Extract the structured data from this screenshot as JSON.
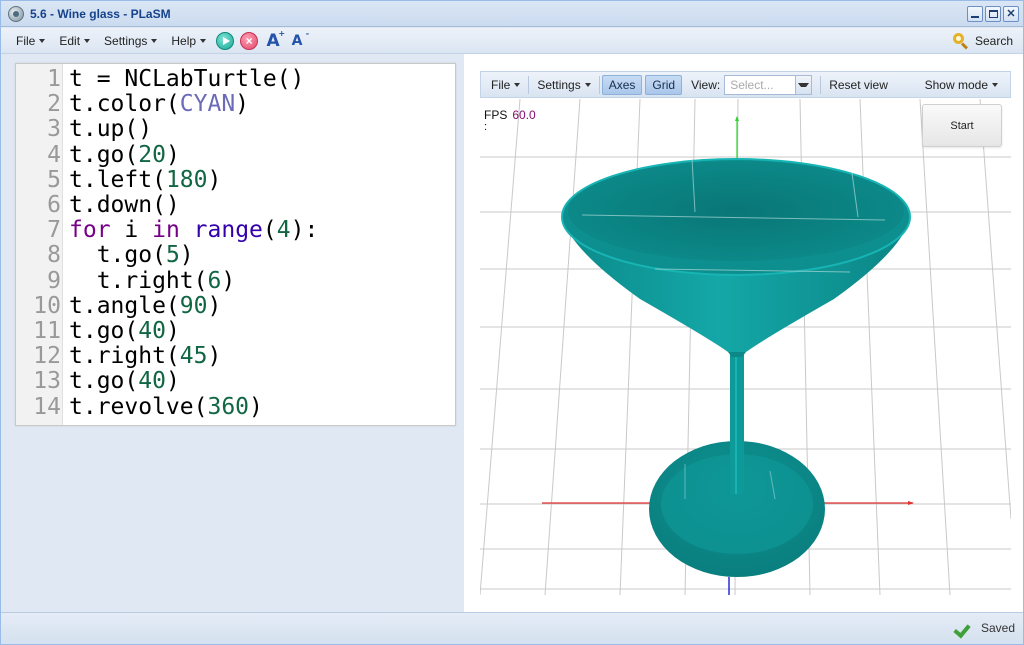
{
  "window": {
    "title": "5.6 - Wine glass - PLaSM"
  },
  "menubar": {
    "items": [
      {
        "label": "File"
      },
      {
        "label": "Edit"
      },
      {
        "label": "Settings"
      },
      {
        "label": "Help"
      }
    ],
    "search_label": "Search",
    "icons": [
      "play-icon",
      "stop-icon",
      "font-increase-icon",
      "font-decrease-icon"
    ]
  },
  "editor": {
    "lines": [
      {
        "n": "1",
        "tokens": [
          [
            "",
            "t = NCLabTurtle()"
          ]
        ]
      },
      {
        "n": "2",
        "tokens": [
          [
            "",
            "t.color("
          ],
          [
            "str",
            "CYAN"
          ],
          [
            "",
            ")"
          ]
        ]
      },
      {
        "n": "3",
        "tokens": [
          [
            "",
            "t.up()"
          ]
        ]
      },
      {
        "n": "4",
        "tokens": [
          [
            "",
            "t.go("
          ],
          [
            "num",
            "20"
          ],
          [
            "",
            ")"
          ]
        ]
      },
      {
        "n": "5",
        "tokens": [
          [
            "",
            "t.left("
          ],
          [
            "num",
            "180"
          ],
          [
            "",
            ")"
          ]
        ]
      },
      {
        "n": "6",
        "tokens": [
          [
            "",
            "t.down()"
          ]
        ]
      },
      {
        "n": "7",
        "tokens": [
          [
            "kw",
            "for"
          ],
          [
            "",
            " i "
          ],
          [
            "kw",
            "in"
          ],
          [
            "",
            " "
          ],
          [
            "bi",
            "range"
          ],
          [
            "",
            "("
          ],
          [
            "num",
            "4"
          ],
          [
            "",
            "):"
          ]
        ]
      },
      {
        "n": "8",
        "tokens": [
          [
            "",
            "  t.go("
          ],
          [
            "num",
            "5"
          ],
          [
            "",
            ")"
          ]
        ]
      },
      {
        "n": "9",
        "tokens": [
          [
            "",
            "  t.right("
          ],
          [
            "num",
            "6"
          ],
          [
            "",
            ")"
          ]
        ]
      },
      {
        "n": "10",
        "tokens": [
          [
            "",
            "t.angle("
          ],
          [
            "num",
            "90"
          ],
          [
            "",
            ")"
          ]
        ]
      },
      {
        "n": "11",
        "tokens": [
          [
            "",
            "t.go("
          ],
          [
            "num",
            "40"
          ],
          [
            "",
            ")"
          ]
        ]
      },
      {
        "n": "12",
        "tokens": [
          [
            "",
            "t.right("
          ],
          [
            "num",
            "45"
          ],
          [
            "",
            ")"
          ]
        ]
      },
      {
        "n": "13",
        "tokens": [
          [
            "",
            "t.go("
          ],
          [
            "num",
            "40"
          ],
          [
            "",
            ")"
          ]
        ]
      },
      {
        "n": "14",
        "tokens": [
          [
            "",
            "t.revolve("
          ],
          [
            "num",
            "360"
          ],
          [
            "",
            ")"
          ]
        ]
      }
    ]
  },
  "viewer": {
    "toolbar": {
      "file_label": "File",
      "settings_label": "Settings",
      "axes_label": "Axes",
      "grid_label": "Grid",
      "view_label": "View:",
      "view_placeholder": "Select...",
      "reset_label": "Reset view",
      "show_mode_label": "Show mode"
    },
    "fps_label": "FPS",
    "fps_value": "60.0",
    "fps_extra": ":",
    "start_label": "Start",
    "colors": {
      "model": "#0f9b9b",
      "x_axis": "#e02020",
      "y_axis": "#20d020",
      "z_axis": "#2020d0",
      "grid": "#c8c8c8"
    }
  },
  "status": {
    "saved_label": "Saved"
  }
}
